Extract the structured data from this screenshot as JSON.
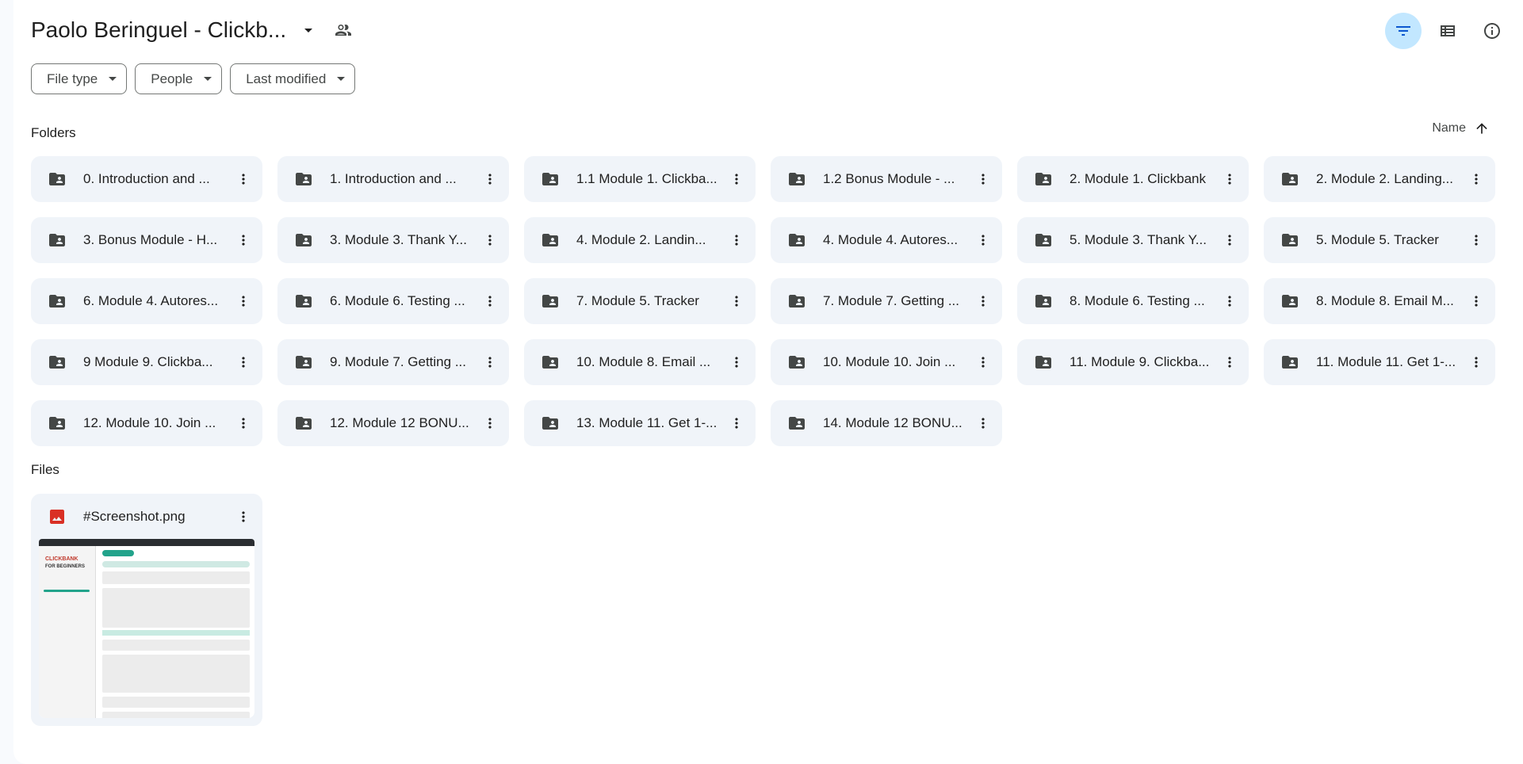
{
  "header": {
    "title": "Paolo Beringuel - Clickb...",
    "icons": {
      "caret": "arrow-drop-down-icon",
      "share": "people-icon",
      "filter": "filter-list-icon",
      "layout": "list-view-icon",
      "info": "info-icon"
    }
  },
  "filters": [
    {
      "label": "File type"
    },
    {
      "label": "People"
    },
    {
      "label": "Last modified"
    }
  ],
  "folders_section": {
    "label": "Folders",
    "sort_label": "Name",
    "items": [
      "0. Introduction and ...",
      "1. Introduction and ...",
      "1.1 Module 1. Clickba...",
      "1.2 Bonus Module - ...",
      "2. Module 1. Clickbank",
      "2. Module 2. Landing...",
      "3. Bonus Module - H...",
      "3. Module 3. Thank Y...",
      "4. Module 2. Landin...",
      "4. Module 4. Autores...",
      "5. Module 3. Thank Y...",
      "5. Module 5. Tracker",
      "6. Module 4. Autores...",
      "6. Module 6. Testing ...",
      "7. Module 5. Tracker",
      "7. Module 7. Getting ...",
      "8. Module 6. Testing ...",
      "8. Module 8. Email M...",
      "9 Module 9. Clickba...",
      "9. Module 7. Getting ...",
      "10. Module 8. Email ...",
      "10. Module 10. Join ...",
      "11. Module 9. Clickba...",
      "11. Module 11. Get 1-...",
      "12. Module 10. Join ...",
      "12. Module 12 BONU...",
      "13. Module 11. Get 1-...",
      "14. Module 12 BONU..."
    ]
  },
  "files_section": {
    "label": "Files",
    "items": [
      {
        "name": "#Screenshot.png",
        "type_icon": "image-icon",
        "thumb_logo": "CLICKBANK",
        "thumb_sub": "FOR BEGINNERS"
      }
    ]
  },
  "colors": {
    "accent": "#c2e7ff",
    "card": "#f0f4f9",
    "image_icon": "#d93025"
  }
}
